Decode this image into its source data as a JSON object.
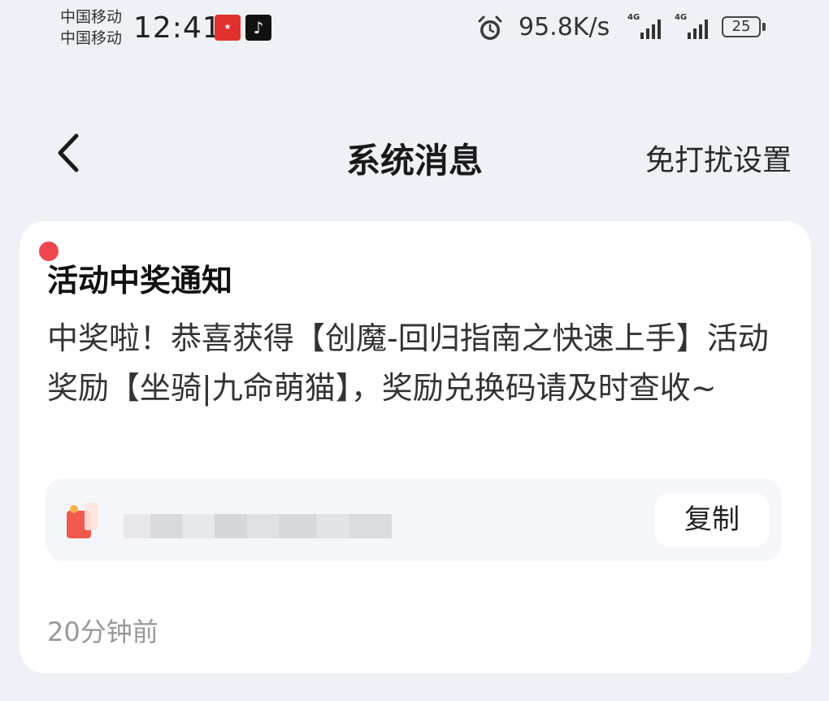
{
  "status_bar": {
    "carrier_1": "中国移动",
    "carrier_2": "中国移动",
    "time": "12:41",
    "net_speed": "95.8K/s",
    "signal_1_tag": "4G",
    "signal_2_tag": "4G",
    "battery": "25",
    "icons": [
      "app-icon-red",
      "tiktok-icon",
      "alarm-icon",
      "signal-icon",
      "battery-icon"
    ]
  },
  "navbar": {
    "title": "系统消息",
    "right_action": "免打扰设置",
    "back_icon": "chevron-left-icon"
  },
  "message": {
    "title": "活动中奖通知",
    "body": "中奖啦！恭喜获得【创魔-回归指南之快速上手】活动奖励【坐骑|九命萌猫】，奖励兑换码请及时查收~",
    "copy_label": "复制",
    "timestamp": "20分钟前",
    "unread": true
  },
  "colors": {
    "background": "#eef1f6",
    "card": "#ffffff",
    "unread_dot": "#f0464d",
    "code_box": "#f4f6f9",
    "timestamp": "#999999"
  }
}
